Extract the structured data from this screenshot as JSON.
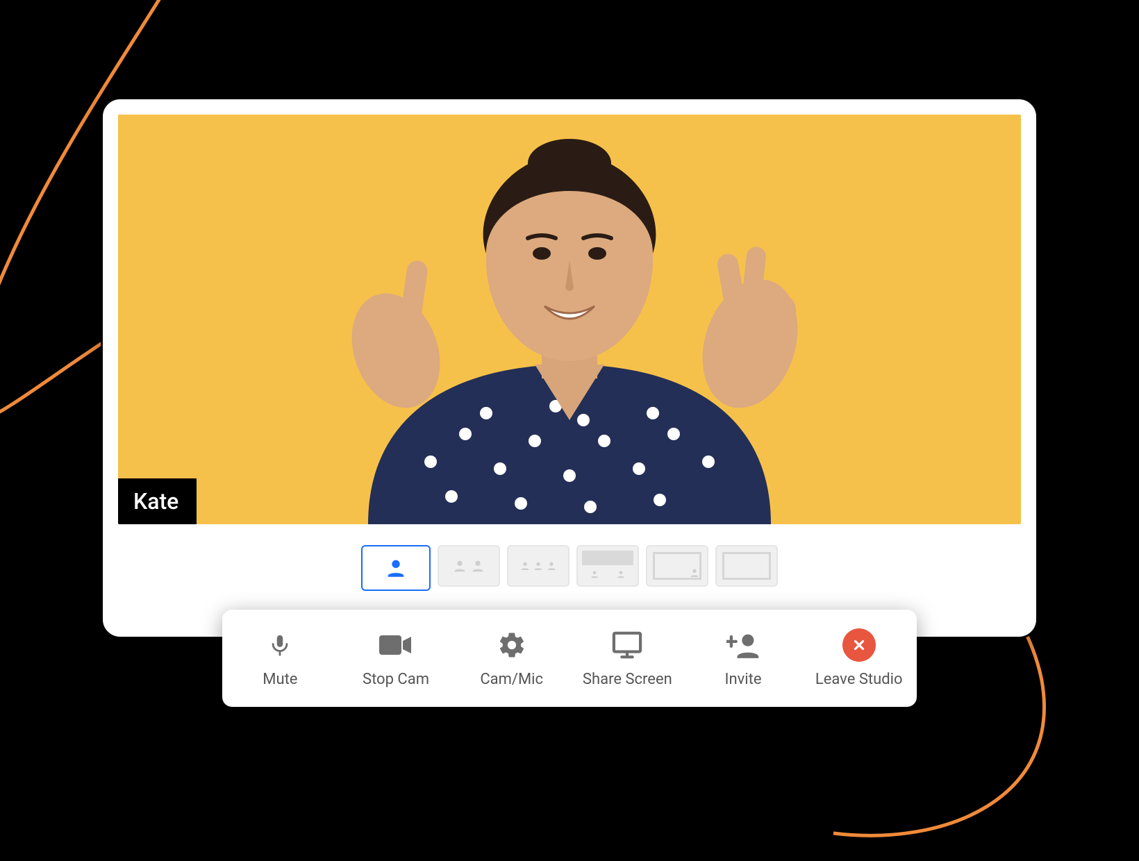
{
  "participant": {
    "name": "Kate"
  },
  "layouts": {
    "active_index": 0,
    "items": [
      {
        "id": "solo",
        "name": "solo-layout"
      },
      {
        "id": "duo",
        "name": "duo-layout"
      },
      {
        "id": "grid3",
        "name": "grid-3-layout"
      },
      {
        "id": "grid4",
        "name": "grid-4-layout"
      },
      {
        "id": "pip",
        "name": "pip-layout"
      },
      {
        "id": "screen",
        "name": "screen-layout"
      }
    ]
  },
  "toolbar": {
    "mute_label": "Mute",
    "stop_cam_label": "Stop Cam",
    "cam_mic_label": "Cam/Mic",
    "share_screen_label": "Share Screen",
    "invite_label": "Invite",
    "leave_label": "Leave Studio"
  },
  "colors": {
    "accent_blue": "#1a6dff",
    "bg_yellow": "#f6c14b",
    "swoosh_orange": "#f08a3a",
    "leave_red": "#e8563f",
    "icon_gray": "#6e6e6e"
  }
}
